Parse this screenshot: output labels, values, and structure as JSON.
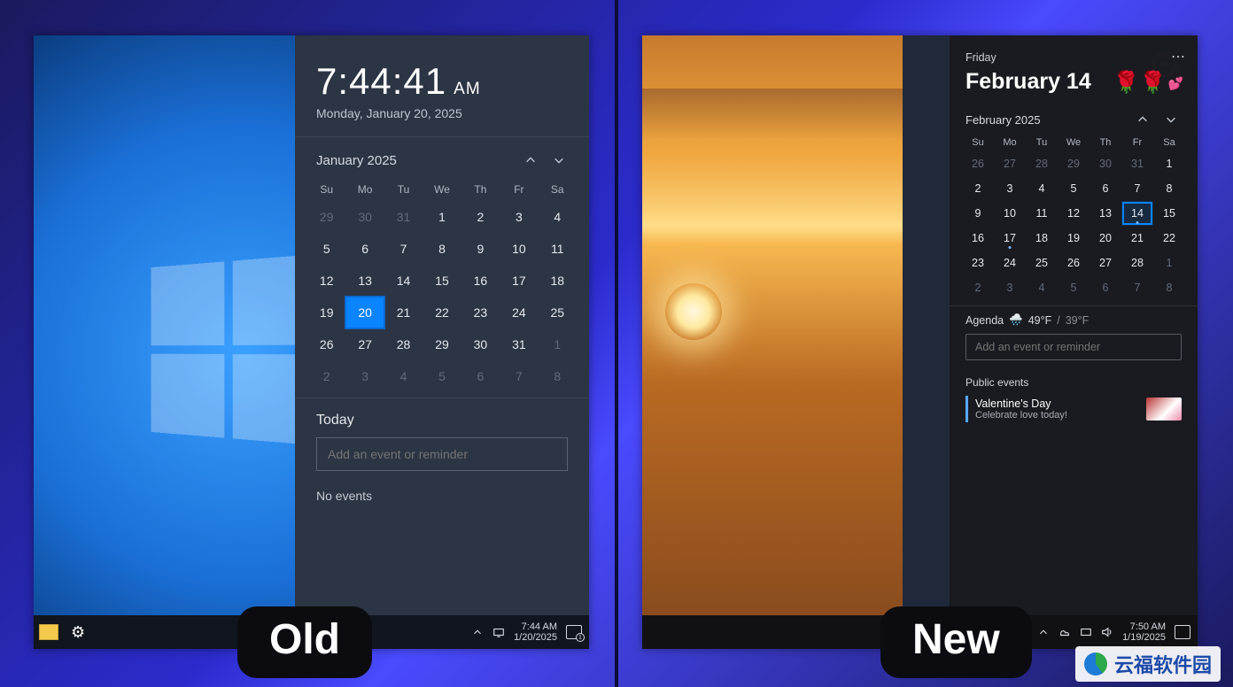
{
  "labels": {
    "old": "Old",
    "new": "New"
  },
  "old": {
    "time": "7:44:41",
    "ampm": "AM",
    "fulldate": "Monday, January 20, 2025",
    "month_label": "January 2025",
    "dow": [
      "Su",
      "Mo",
      "Tu",
      "We",
      "Th",
      "Fr",
      "Sa"
    ],
    "weeks": [
      [
        {
          "d": "29",
          "dim": true
        },
        {
          "d": "30",
          "dim": true
        },
        {
          "d": "31",
          "dim": true
        },
        {
          "d": "1"
        },
        {
          "d": "2"
        },
        {
          "d": "3"
        },
        {
          "d": "4"
        }
      ],
      [
        {
          "d": "5"
        },
        {
          "d": "6"
        },
        {
          "d": "7"
        },
        {
          "d": "8"
        },
        {
          "d": "9"
        },
        {
          "d": "10"
        },
        {
          "d": "11"
        }
      ],
      [
        {
          "d": "12"
        },
        {
          "d": "13"
        },
        {
          "d": "14"
        },
        {
          "d": "15"
        },
        {
          "d": "16"
        },
        {
          "d": "17"
        },
        {
          "d": "18"
        }
      ],
      [
        {
          "d": "19"
        },
        {
          "d": "20",
          "today": true
        },
        {
          "d": "21"
        },
        {
          "d": "22"
        },
        {
          "d": "23"
        },
        {
          "d": "24"
        },
        {
          "d": "25"
        }
      ],
      [
        {
          "d": "26"
        },
        {
          "d": "27"
        },
        {
          "d": "28"
        },
        {
          "d": "29"
        },
        {
          "d": "30"
        },
        {
          "d": "31"
        },
        {
          "d": "1",
          "dim": true
        }
      ],
      [
        {
          "d": "2",
          "dim": true
        },
        {
          "d": "3",
          "dim": true
        },
        {
          "d": "4",
          "dim": true
        },
        {
          "d": "5",
          "dim": true
        },
        {
          "d": "6",
          "dim": true
        },
        {
          "d": "7",
          "dim": true
        },
        {
          "d": "8",
          "dim": true
        }
      ]
    ],
    "agenda_header": "Today",
    "agenda_placeholder": "Add an event or reminder",
    "no_events": "No events",
    "taskbar": {
      "time": "7:44 AM",
      "date": "1/20/2025",
      "notif_count": "1"
    }
  },
  "new": {
    "weekday": "Friday",
    "monthday": "February 14",
    "month_label": "February 2025",
    "dow": [
      "Su",
      "Mo",
      "Tu",
      "We",
      "Th",
      "Fr",
      "Sa"
    ],
    "weeks": [
      [
        {
          "d": "26",
          "dim": true
        },
        {
          "d": "27",
          "dim": true
        },
        {
          "d": "28",
          "dim": true
        },
        {
          "d": "29",
          "dim": true
        },
        {
          "d": "30",
          "dim": true
        },
        {
          "d": "31",
          "dim": true
        },
        {
          "d": "1"
        }
      ],
      [
        {
          "d": "2"
        },
        {
          "d": "3"
        },
        {
          "d": "4"
        },
        {
          "d": "5"
        },
        {
          "d": "6"
        },
        {
          "d": "7"
        },
        {
          "d": "8"
        }
      ],
      [
        {
          "d": "9"
        },
        {
          "d": "10"
        },
        {
          "d": "11"
        },
        {
          "d": "12"
        },
        {
          "d": "13"
        },
        {
          "d": "14",
          "today": true,
          "dot": true
        },
        {
          "d": "15"
        }
      ],
      [
        {
          "d": "16"
        },
        {
          "d": "17",
          "dot": true
        },
        {
          "d": "18"
        },
        {
          "d": "19"
        },
        {
          "d": "20"
        },
        {
          "d": "21"
        },
        {
          "d": "22"
        }
      ],
      [
        {
          "d": "23"
        },
        {
          "d": "24"
        },
        {
          "d": "25"
        },
        {
          "d": "26"
        },
        {
          "d": "27"
        },
        {
          "d": "28"
        },
        {
          "d": "1",
          "dim": true
        }
      ],
      [
        {
          "d": "2",
          "dim": true
        },
        {
          "d": "3",
          "dim": true
        },
        {
          "d": "4",
          "dim": true
        },
        {
          "d": "5",
          "dim": true
        },
        {
          "d": "6",
          "dim": true
        },
        {
          "d": "7",
          "dim": true
        },
        {
          "d": "8",
          "dim": true
        }
      ]
    ],
    "agenda_label": "Agenda",
    "weather_icon": "🌧️",
    "temp_hi": "49°F",
    "temp_sep": "/",
    "temp_lo": "39°F",
    "agenda_placeholder": "Add an event or reminder",
    "public_events_label": "Public events",
    "event_title": "Valentine's Day",
    "event_sub": "Celebrate love today!",
    "roses": "🌹🌹",
    "hearts": "💕",
    "taskbar": {
      "time": "7:50 AM",
      "date": "1/19/2025"
    }
  },
  "watermark": "云福软件园"
}
